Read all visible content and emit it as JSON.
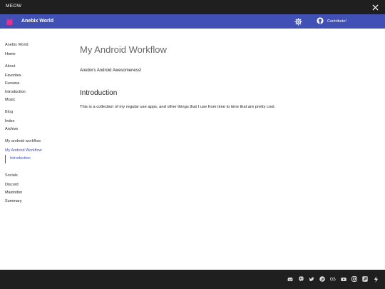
{
  "window": {
    "title": "MEOW"
  },
  "header": {
    "site_title": "Anebix World",
    "contribute_label": "Contribute!"
  },
  "sidebar": {
    "group1": {
      "title": "Anebix World",
      "items": [
        "Home"
      ]
    },
    "group2": {
      "title": "About",
      "items": [
        "Favorites",
        "Fursona",
        "Introduction",
        "Music"
      ]
    },
    "group3": {
      "title": "Blog",
      "items": [
        "Index",
        "Archive"
      ]
    },
    "group4": {
      "title": "My android workflow",
      "items": [
        "My Android Workflow"
      ],
      "subitems": [
        "Introduction"
      ]
    },
    "group5": {
      "title": "Socials",
      "items": [
        "Discord",
        "Mastodon",
        "Summary"
      ]
    }
  },
  "main": {
    "title": "My Android Workflow",
    "lead": "Anebix's Android Awesomeness!",
    "section_title": "Introduction",
    "body": "This is a collection of my regular use apps, and other things that I use from time to time that are pretty cool."
  },
  "footer": {
    "icons": [
      "discord-icon",
      "mastodon-icon",
      "twitter-icon",
      "pinterest-icon",
      "lastfm-icon",
      "youtube-icon",
      "instagram-icon",
      "steam-icon",
      "kofi-icon"
    ]
  },
  "colors": {
    "accent": "#4150b5",
    "chrome": "#1f1f1f"
  }
}
